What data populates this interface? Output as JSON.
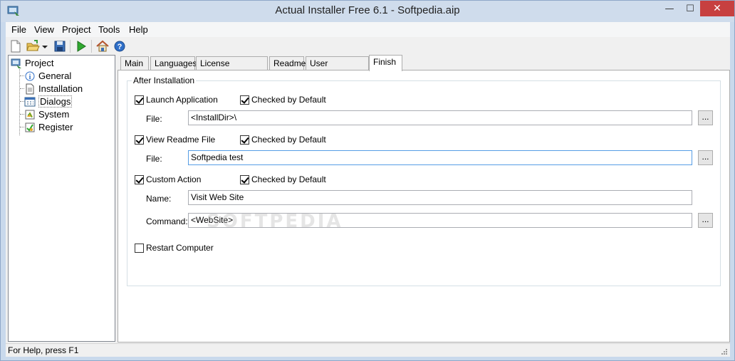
{
  "window": {
    "title": "Actual Installer Free 6.1 - Softpedia.aip",
    "controls": {
      "minimize": "—",
      "maximize": "☐",
      "close": "✕"
    }
  },
  "menu": [
    "File",
    "View",
    "Project",
    "Tools",
    "Help"
  ],
  "toolbar": {
    "icons": [
      "new-file-icon",
      "open-folder-icon",
      "dropdown-arrow-icon",
      "save-icon",
      "build-run-icon",
      "home-icon",
      "help-icon"
    ]
  },
  "tree": {
    "root": "Project",
    "children": [
      "General",
      "Installation",
      "Dialogs",
      "System",
      "Register"
    ],
    "selected": "Dialogs"
  },
  "tabs": [
    "Main",
    "Languages",
    "License Agreement",
    "Readme",
    "User Information",
    "Finish"
  ],
  "active_tab": "Finish",
  "finish": {
    "group_title": "After Installation",
    "launch_app": {
      "label": "Launch Application",
      "checked": true,
      "default_label": "Checked by Default",
      "default_checked": true
    },
    "file1": {
      "label": "File:",
      "value": "<InstallDir>\\",
      "browse": "..."
    },
    "readme": {
      "label": "View Readme File",
      "checked": true,
      "default_label": "Checked by Default",
      "default_checked": true
    },
    "file2": {
      "label": "File:",
      "value": "Softpedia test",
      "browse": "..."
    },
    "custom": {
      "label": "Custom Action",
      "checked": true,
      "default_label": "Checked by Default",
      "default_checked": true
    },
    "name": {
      "label": "Name:",
      "value": "Visit Web Site"
    },
    "command": {
      "label": "Command:",
      "value": "<WebSite>",
      "browse": "..."
    },
    "restart": {
      "label": "Restart Computer",
      "checked": false
    }
  },
  "watermark": "SOFTPEDIA",
  "status": "For Help, press F1",
  "colors": {
    "close_button": "#c74040",
    "frame": "#c9d9ec",
    "focus_border": "#569de5"
  }
}
